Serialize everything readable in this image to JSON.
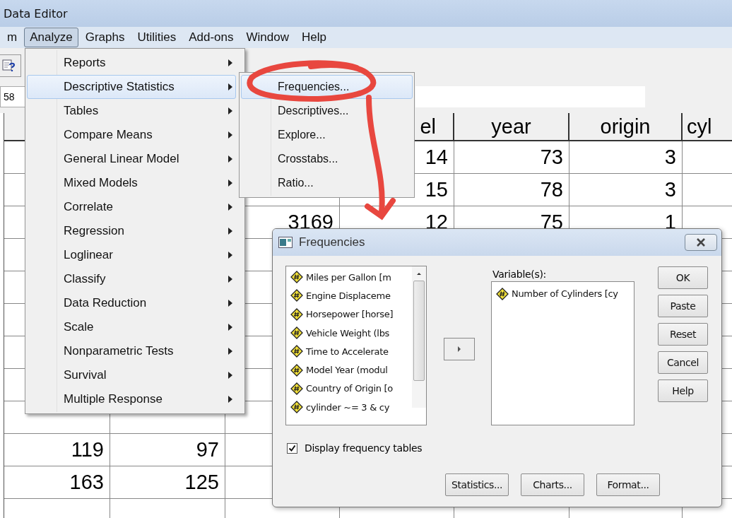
{
  "window": {
    "title": "Data Editor"
  },
  "menu_bar": [
    {
      "label": "m",
      "selected": false
    },
    {
      "label": "Analyze",
      "selected": true
    },
    {
      "label": "Graphs",
      "selected": false
    },
    {
      "label": "Utilities",
      "selected": false
    },
    {
      "label": "Add-ons",
      "selected": false
    },
    {
      "label": "Window",
      "selected": false
    },
    {
      "label": "Help",
      "selected": false
    }
  ],
  "cell_editor": {
    "cell": "58"
  },
  "grid": {
    "columns": [
      null,
      null,
      null,
      "el",
      "year",
      "origin",
      "cyl"
    ],
    "rows": [
      [
        null,
        null,
        null,
        "14",
        "73",
        "3",
        null
      ],
      [
        null,
        null,
        null,
        "15",
        "78",
        "3",
        null
      ],
      [
        null,
        null,
        "3169",
        "12",
        "75",
        "1",
        null
      ],
      [
        null,
        null,
        null,
        null,
        null,
        null,
        null
      ],
      [
        null,
        null,
        null,
        null,
        null,
        null,
        null
      ],
      [
        null,
        null,
        null,
        null,
        null,
        null,
        null
      ],
      [
        null,
        null,
        null,
        null,
        null,
        null,
        null
      ],
      [
        null,
        null,
        null,
        null,
        null,
        null,
        null
      ],
      [
        null,
        null,
        null,
        null,
        null,
        null,
        null
      ],
      [
        "119",
        "97",
        null,
        null,
        null,
        null,
        null
      ],
      [
        "163",
        "125",
        null,
        null,
        null,
        null,
        null
      ],
      [
        null,
        null,
        null,
        null,
        null,
        null,
        null
      ]
    ]
  },
  "analyze_menu": [
    {
      "label": "Reports",
      "selected": false
    },
    {
      "label": "Descriptive Statistics",
      "selected": true
    },
    {
      "label": "Tables",
      "selected": false
    },
    {
      "label": "Compare Means",
      "selected": false
    },
    {
      "label": "General Linear Model",
      "selected": false
    },
    {
      "label": "Mixed Models",
      "selected": false
    },
    {
      "label": "Correlate",
      "selected": false
    },
    {
      "label": "Regression",
      "selected": false
    },
    {
      "label": "Loglinear",
      "selected": false
    },
    {
      "label": "Classify",
      "selected": false
    },
    {
      "label": "Data Reduction",
      "selected": false
    },
    {
      "label": "Scale",
      "selected": false
    },
    {
      "label": "Nonparametric Tests",
      "selected": false
    },
    {
      "label": "Survival",
      "selected": false
    },
    {
      "label": "Multiple Response",
      "selected": false
    }
  ],
  "descriptive_submenu": [
    {
      "label": "Frequencies...",
      "selected": true
    },
    {
      "label": "Descriptives...",
      "selected": false
    },
    {
      "label": "Explore...",
      "selected": false
    },
    {
      "label": "Crosstabs...",
      "selected": false
    },
    {
      "label": "Ratio...",
      "selected": false
    }
  ],
  "dialog": {
    "title": "Frequencies",
    "source_variables": [
      "Miles per Gallon [m",
      "Engine Displaceme",
      "Horsepower [horse]",
      "Vehicle Weight (lbs",
      "Time to Accelerate",
      "Model Year (modul",
      "Country of Origin [o",
      "cylinder ~= 3  &  cy"
    ],
    "target_label": "Variable(s):",
    "target_variables": [
      "Number of Cylinders [cy"
    ],
    "side_buttons": [
      "OK",
      "Paste",
      "Reset",
      "Cancel",
      "Help"
    ],
    "display_frequency_tables": {
      "label": "Display frequency tables",
      "checked": true
    },
    "bottom_buttons": [
      "Statistics...",
      "Charts...",
      "Format..."
    ]
  }
}
